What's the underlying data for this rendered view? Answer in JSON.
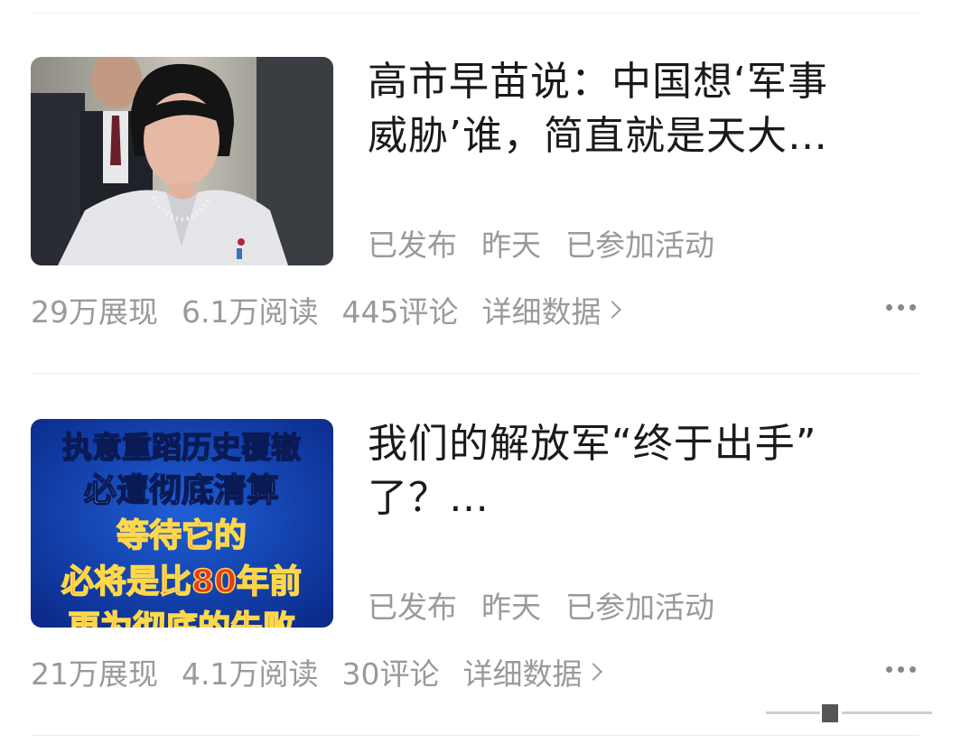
{
  "articles": [
    {
      "title": "高市早苗说：中国想‘军事\n威胁’谁，简直就是天大…",
      "status": "已发布",
      "time": "昨天",
      "activity": "已参加活动",
      "impressions": "29万展现",
      "reads": "6.1万阅读",
      "comments": "445评论",
      "detail": "详细数据"
    },
    {
      "title": "我们的解放军“终于出手”\n了？…",
      "status": "已发布",
      "time": "昨天",
      "activity": "已参加活动",
      "impressions": "21万展现",
      "reads": "4.1万阅读",
      "comments": "30评论",
      "detail": "详细数据",
      "thumb_text": [
        "执意重蹈历史覆辙",
        "必遭彻底清算",
        "等待它的",
        "必将是比80年前",
        "更为彻底的失败"
      ]
    }
  ],
  "colors": {
    "text_primary": "#1a1a1a",
    "text_secondary": "#9a9a9a",
    "divider": "#ececec"
  }
}
